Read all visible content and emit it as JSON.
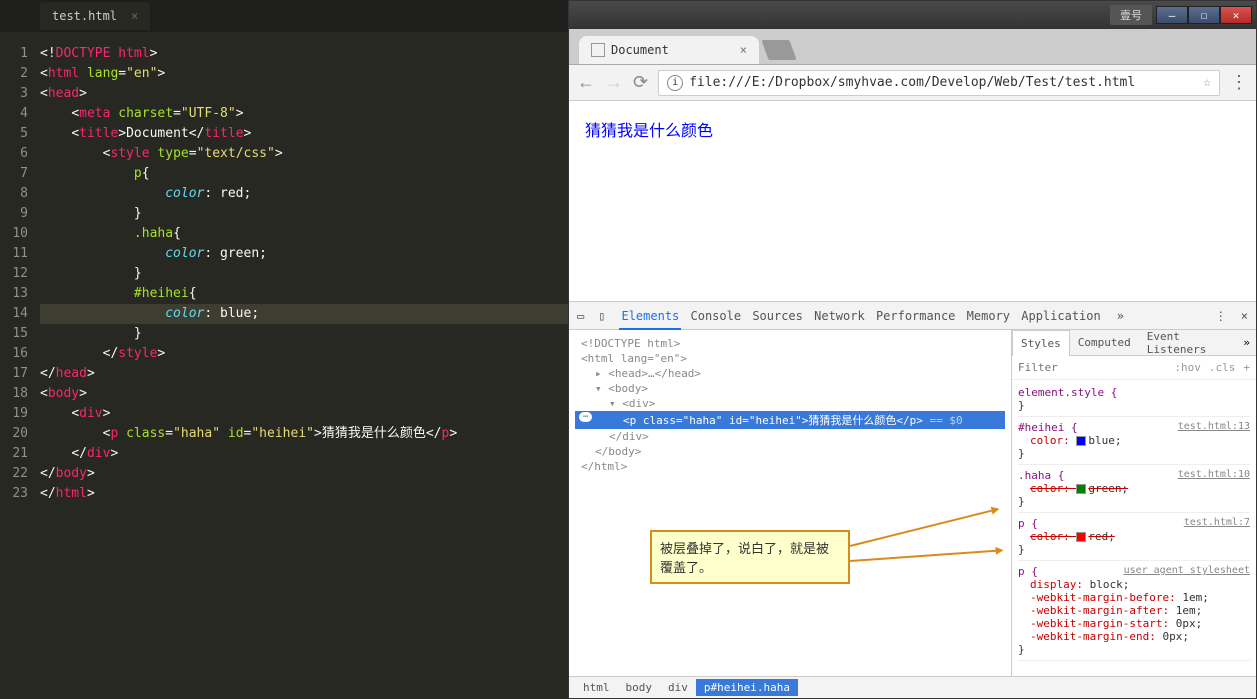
{
  "editor": {
    "tab_name": "test.html",
    "lines": [
      1,
      2,
      3,
      4,
      5,
      6,
      7,
      8,
      9,
      10,
      11,
      12,
      13,
      14,
      15,
      16,
      17,
      18,
      19,
      20,
      21,
      22,
      23
    ],
    "code_tokens": {
      "doctype_decl": "DOCTYPE html",
      "html_tag": "html",
      "lang_attr": "lang",
      "lang_val": "\"en\"",
      "head_tag": "head",
      "meta_tag": "meta",
      "charset_attr": "charset",
      "charset_val": "\"UTF-8\"",
      "title_tag": "title",
      "title_text": "Document",
      "style_tag": "style",
      "type_attr": "type",
      "type_val": "\"text/css\"",
      "sel_p": "p",
      "sel_haha": ".haha",
      "sel_heihei": "#heihei",
      "prop_color": "color",
      "val_red": "red",
      "val_green": "green",
      "val_blue": "blue",
      "body_tag": "body",
      "div_tag": "div",
      "p_tag": "p",
      "class_attr": "class",
      "class_val": "\"haha\"",
      "id_attr": "id",
      "id_val": "\"heihei\"",
      "p_text": "猜猜我是什么颜色"
    }
  },
  "browser": {
    "window_label": "壹号",
    "tab_title": "Document",
    "url": "file:///E:/Dropbox/smyhvae.com/Develop/Web/Test/test.html",
    "page_text": "猜猜我是什么颜色"
  },
  "devtools": {
    "tabs": [
      "Elements",
      "Console",
      "Sources",
      "Network",
      "Performance",
      "Memory",
      "Application"
    ],
    "elements": {
      "doctype": "<!DOCTYPE html>",
      "html_open": "<html lang=\"en\">",
      "head": "<head>…</head>",
      "body_open": "<body>",
      "div_open": "<div>",
      "selected_p_open": "<p class=\"haha\" id=\"heihei\">",
      "selected_p_text": "猜猜我是什么颜色",
      "selected_p_close": "</p>",
      "selected_dim": " == $0",
      "div_close": "</div>",
      "body_close": "</body>",
      "html_close": "</html>"
    },
    "breadcrumb": [
      "html",
      "body",
      "div",
      "p#heihei.haha"
    ],
    "styles_tabs": [
      "Styles",
      "Computed",
      "Event Listeners"
    ],
    "filter_placeholder": "Filter",
    "filter_hov": ":hov",
    "filter_cls": ".cls",
    "filter_plus": "+",
    "rules": [
      {
        "sel": "element.style {",
        "src": "",
        "props": [],
        "close": "}"
      },
      {
        "sel": "#heihei {",
        "src": "test.html:13",
        "props": [
          {
            "name": "color",
            "val": "blue",
            "color": "#0000ff",
            "over": false
          }
        ],
        "close": "}"
      },
      {
        "sel": ".haha {",
        "src": "test.html:10",
        "props": [
          {
            "name": "color",
            "val": "green",
            "color": "#008000",
            "over": true
          }
        ],
        "close": "}"
      },
      {
        "sel": "p {",
        "src": "test.html:7",
        "props": [
          {
            "name": "color",
            "val": "red",
            "color": "#ff0000",
            "over": true
          }
        ],
        "close": "}"
      },
      {
        "sel": "p {",
        "src": "user agent stylesheet",
        "props": [
          {
            "name": "display",
            "val": "block",
            "over": false
          },
          {
            "name": "-webkit-margin-before",
            "val": "1em",
            "over": false
          },
          {
            "name": "-webkit-margin-after",
            "val": "1em",
            "over": false
          },
          {
            "name": "-webkit-margin-start",
            "val": "0px",
            "over": false
          },
          {
            "name": "-webkit-margin-end",
            "val": "0px",
            "over": false
          }
        ],
        "close": "}"
      }
    ]
  },
  "callout": {
    "text": "被层叠掉了，说白了，就是被覆盖了。"
  }
}
